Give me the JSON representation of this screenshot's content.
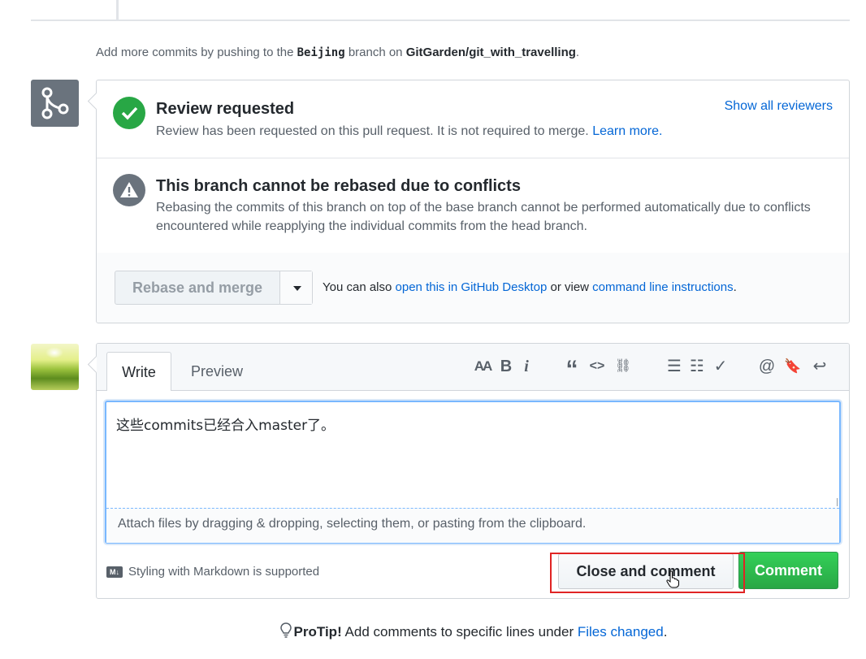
{
  "push_note": {
    "prefix": "Add more commits by pushing to the",
    "branch": "Beijing",
    "middle": "branch on",
    "repo": "GitGarden/git_with_travelling",
    "suffix": "."
  },
  "review": {
    "title": "Review requested",
    "description": "Review has been requested on this pull request. It is not required to merge.",
    "learn_more": "Learn more.",
    "show_all": "Show all reviewers"
  },
  "conflict": {
    "title": "This branch cannot be rebased due to conflicts",
    "description": "Rebasing the commits of this branch on top of the base branch cannot be performed automatically due to conflicts encountered while reapplying the individual commits from the head branch."
  },
  "merge_actions": {
    "rebase_label": "Rebase and merge",
    "also_prefix": "You can also",
    "desktop_link": "open this in GitHub Desktop",
    "or_view": "or view",
    "cli_link": "command line instructions",
    "suffix": "."
  },
  "comment": {
    "tabs": [
      "Write",
      "Preview"
    ],
    "toolbar": {
      "header": "AA",
      "bold": "B",
      "italic": "i",
      "quote": "“",
      "code": "<>",
      "link": "⛓",
      "bullet_list": "☰",
      "numbered_list": "☷",
      "task_list": "✓",
      "mention": "@",
      "bookmark": "🔖",
      "reply": "↩"
    },
    "body_value": "这些commits已经合入master了。",
    "attach_hint": "Attach files by dragging & dropping, selecting them, or pasting from the clipboard.",
    "markdown_badge": "M↓",
    "markdown_note": "Styling with Markdown is supported",
    "close_label": "Close and comment",
    "comment_label": "Comment"
  },
  "protip": {
    "label": "ProTip!",
    "text": "Add comments to specific lines under",
    "link": "Files changed",
    "suffix": "."
  },
  "colors": {
    "link": "#0366d6",
    "success": "#28a745",
    "muted": "#586069",
    "highlight": "#e02424"
  }
}
